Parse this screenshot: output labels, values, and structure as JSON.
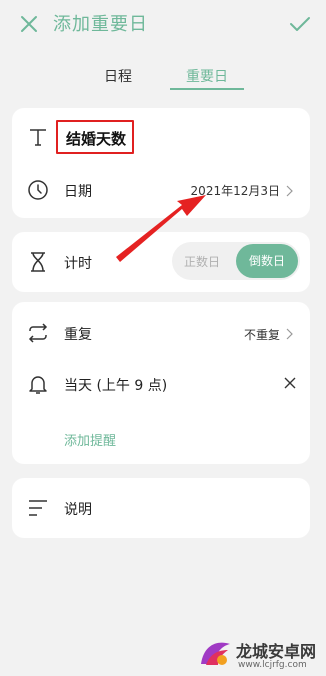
{
  "header": {
    "title": "添加重要日",
    "close_icon": "close-icon",
    "confirm_icon": "check-icon"
  },
  "tabs": [
    {
      "label": "日程",
      "active": false
    },
    {
      "label": "重要日",
      "active": true
    }
  ],
  "form": {
    "name_value": "结婚天数",
    "date_label": "日期",
    "date_value": "2021年12月3日",
    "timer_label": "计时",
    "timer_options": [
      "正数日",
      "倒数日"
    ],
    "timer_selected": "倒数日",
    "repeat_label": "重复",
    "repeat_value": "不重复",
    "reminder_label": "当天 (上午 9 点)",
    "add_reminder_label": "添加提醒",
    "note_label": "说明"
  },
  "watermark": {
    "line1": "龙城安卓网",
    "line2": "www.lcjrfg.com"
  },
  "colors": {
    "accent": "#6fb89a",
    "highlight_box": "#e02020",
    "arrow": "#e52222",
    "background": "#f2f2f2"
  }
}
